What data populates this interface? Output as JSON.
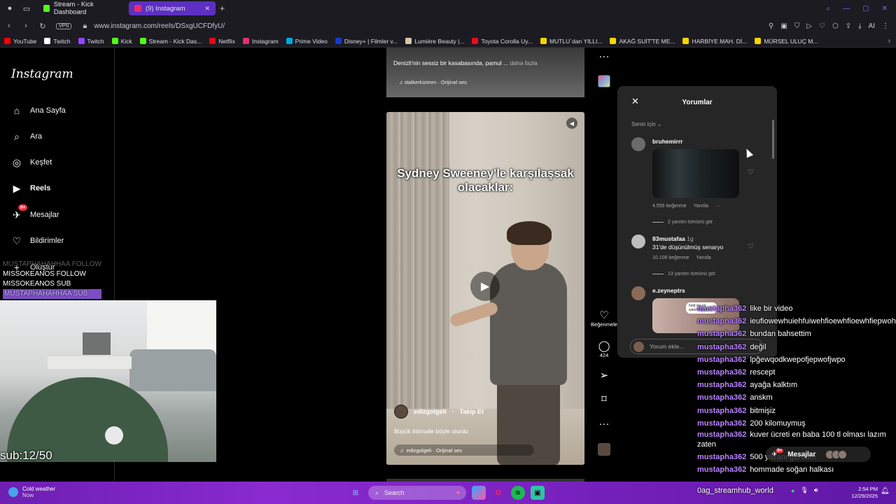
{
  "browser": {
    "tabs": [
      {
        "title": "Stream - Kick Dashboard",
        "color": "#53fc18"
      },
      {
        "title": "(9) Instagram",
        "color": "#e1306c"
      }
    ],
    "url": "www.instagram.com/reels/DSxgUCFDfyU/",
    "vpn_label": "VPN",
    "bookmarks": [
      {
        "label": "YouTube",
        "color": "#ff0000"
      },
      {
        "label": "Twitch",
        "color": "#ffffff"
      },
      {
        "label": "Twitch",
        "color": "#9146ff"
      },
      {
        "label": "Kick",
        "color": "#53fc18"
      },
      {
        "label": "Stream - Kick Das...",
        "color": "#53fc18"
      },
      {
        "label": "Netflix",
        "color": "#e50914"
      },
      {
        "label": "Instagram",
        "color": "#e1306c"
      },
      {
        "label": "Prime Video",
        "color": "#00a8e1"
      },
      {
        "label": "Disney+ | Filmler v...",
        "color": "#113ccf"
      },
      {
        "label": "Lumière Beauty |...",
        "color": "#d8c7a6"
      },
      {
        "label": "Toyota Corolla Uy...",
        "color": "#eb0a1e"
      },
      {
        "label": "MUTLU´dan YILLI...",
        "color": "#f2d600"
      },
      {
        "label": "AKAĞ SUİT'TE ME...",
        "color": "#f2d600"
      },
      {
        "label": "HARBİYE MAH. Dİ...",
        "color": "#f2d600"
      },
      {
        "label": "MÜRSEL ULUÇ M...",
        "color": "#f2d600"
      }
    ]
  },
  "instagram": {
    "logo": "Instagram",
    "nav": [
      {
        "label": "Ana Sayfa",
        "icon": "home-icon"
      },
      {
        "label": "Ara",
        "icon": "search-icon"
      },
      {
        "label": "Keşfet",
        "icon": "compass-icon"
      },
      {
        "label": "Reels",
        "icon": "reels-icon"
      },
      {
        "label": "Mesajlar",
        "icon": "messenger-icon",
        "badge": "9+"
      },
      {
        "label": "Bildirimler",
        "icon": "heart-icon"
      },
      {
        "label": "Oluştur",
        "icon": "plus-icon"
      }
    ],
    "prev_reel": {
      "caption": "Denizli'nin sessiz bir kasabasında, pamul ...",
      "more": "daha fazla",
      "audio": "stalkerkizimm · Orijinal ses"
    },
    "reel": {
      "overlay_text": "Sydney Sweeney'le karşılaşsak olacaklar:",
      "username": "edizgolgeli",
      "follow": "Takip Et",
      "caption": "Büyük ihtimalle böyle olurdu",
      "audio": "edizgolgeli · Orijinal ses"
    },
    "actions": {
      "like_label": "Beğenmele",
      "comment_count": "424"
    },
    "comments": {
      "title": "Yorumlar",
      "filter": "Senin için",
      "items": [
        {
          "user": "bruhemirrr",
          "likes": "4.556 beğenme",
          "reply": "Yanıtla",
          "replies": "2 yanıtın tümünü gör"
        },
        {
          "user": "83mustafaa",
          "time": "1g",
          "text": "31'de düşünülmüş senaryo",
          "likes": "10.108 beğenme",
          "reply": "Yanıtla",
          "replies": "13 yanıtın tümünü gör"
        },
        {
          "user": "e.zeyneptrs",
          "sticker_text": "hold me im watching you"
        }
      ],
      "input_placeholder": "Yorum ekle..."
    },
    "messages_pill": {
      "label": "Mesajlar",
      "badge": "9+"
    }
  },
  "stream_overlay": {
    "events": [
      {
        "text": "MUSTAPHAHAHHAA  FOLLOW",
        "style": "dim"
      },
      {
        "text": "MISSOKEANOS  FOLLOW",
        "style": "normal"
      },
      {
        "text": "MISSOKEANOS  SUB",
        "style": "normal"
      },
      {
        "text": "MUSTAPHAHAHHAA  SUB",
        "style": "hl"
      }
    ],
    "sub_goal": "sub:12/50",
    "chat": [
      {
        "user": "mustapha362",
        "text": "like bir video"
      },
      {
        "user": "mustapha362",
        "text": "ieufiowewhuiehfuiwehfioewhfioewhfiepwoh"
      },
      {
        "user": "mustapha362",
        "text": "bundan bahsettim"
      },
      {
        "user": "mustapha362",
        "text": "değil"
      },
      {
        "user": "mustapha362",
        "text": "lpğewqodkwepofjepwofjwpo"
      },
      {
        "user": "mustapha362",
        "text": "rescept"
      },
      {
        "user": "mustapha362",
        "text": "ayağa kalktım"
      },
      {
        "user": "mustapha362",
        "text": "anskm"
      },
      {
        "user": "mustapha362",
        "text": "bitmişiz"
      },
      {
        "user": "mustapha362",
        "text": "200 kilomuymuş"
      },
      {
        "user": "mustapha362",
        "text": "kuver ücreti en baba 100 tl olması lazım zaten"
      },
      {
        "user": "mustapha362",
        "text": "500 yazanı gördüm"
      },
      {
        "user": "mustapha362",
        "text": "hommade soğan halkası"
      }
    ],
    "channel": "0ag_streamhub_world"
  },
  "taskbar": {
    "weather_title": "Cold weather",
    "weather_sub": "Now",
    "search_label": "Search",
    "time": "2:54 PM",
    "date": "12/29/2025"
  }
}
